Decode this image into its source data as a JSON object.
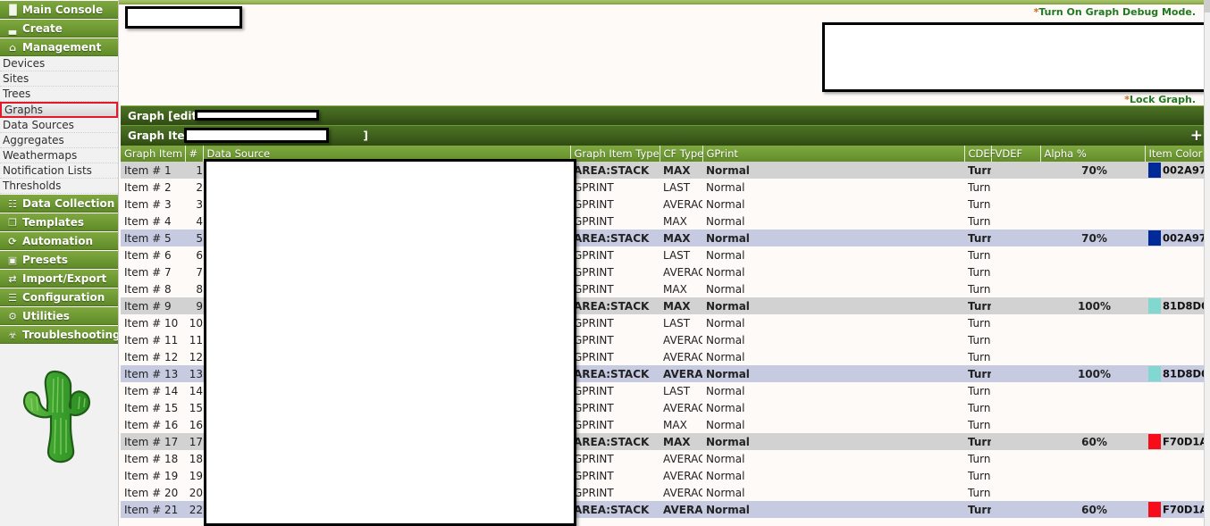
{
  "sidebar": {
    "groups_top": [
      {
        "label": "Main Console",
        "icon": "console-icon",
        "glyph": "▐▌"
      },
      {
        "label": "Create",
        "icon": "create-chart-icon",
        "glyph": "▃"
      },
      {
        "label": "Management",
        "icon": "home-icon",
        "glyph": "⌂"
      }
    ],
    "sub_items": [
      {
        "label": "Devices",
        "selected": false
      },
      {
        "label": "Sites",
        "selected": false
      },
      {
        "label": "Trees",
        "selected": false
      },
      {
        "label": "Graphs",
        "selected": true
      },
      {
        "label": "Data Sources",
        "selected": false
      },
      {
        "label": "Aggregates",
        "selected": false
      },
      {
        "label": "Weathermaps",
        "selected": false
      },
      {
        "label": "Notification Lists",
        "selected": false
      },
      {
        "label": "Thresholds",
        "selected": false
      }
    ],
    "groups_bottom": [
      {
        "label": "Data Collection",
        "icon": "database-icon",
        "glyph": "☷"
      },
      {
        "label": "Templates",
        "icon": "copy-icon",
        "glyph": "❐"
      },
      {
        "label": "Automation",
        "icon": "gear-rotate-icon",
        "glyph": "⟳"
      },
      {
        "label": "Presets",
        "icon": "window-icon",
        "glyph": "▣"
      },
      {
        "label": "Import/Export",
        "icon": "exchange-arrows-icon",
        "glyph": "⇄"
      },
      {
        "label": "Configuration",
        "icon": "sliders-icon",
        "glyph": "☰"
      },
      {
        "label": "Utilities",
        "icon": "cogs-icon",
        "glyph": "⚙"
      },
      {
        "label": "Troubleshooting",
        "icon": "bug-icon",
        "glyph": "☣"
      }
    ],
    "logo_alt": "cacti-cactus-logo"
  },
  "notes": {
    "debug_asterisk": "*",
    "debug_text": "Turn On Graph Debug Mode.",
    "lock_asterisk": "*",
    "lock_text": "Lock Graph."
  },
  "panel": {
    "graph_edit_label": "Graph [edit:",
    "graph_items_label": "Graph Items",
    "graph_items_close_bracket": "]",
    "add_button_glyph": "+"
  },
  "table": {
    "headers": {
      "graph_item": "Graph Item",
      "num": "#",
      "data_source": "Data Source",
      "graph_item_type": "Graph Item Type",
      "cf_type": "CF Type",
      "gprint": "GPrint",
      "cdef": "CDEF",
      "vdef": "VDEF",
      "alpha": "Alpha %",
      "item_color": "Item Color"
    },
    "rows": [
      {
        "item": "Item # 1",
        "num": "1",
        "hr": "",
        "type": "AREA:STACK",
        "cf": "MAX",
        "gprint": "Normal",
        "cdef": "Turn Bytes into Bits",
        "vdef": "",
        "alpha": "70%",
        "color": "002A97",
        "color_hex": "#002A97",
        "style": "gray",
        "down": true,
        "up": false,
        "del": true
      },
      {
        "item": "Item # 2",
        "num": "2",
        "hr": "",
        "type": "GPRINT",
        "cf": "LAST",
        "gprint": "Normal",
        "cdef": "Turn Bytes into Bits",
        "vdef": "",
        "alpha": "",
        "color": "",
        "color_hex": "",
        "style": "normal",
        "down": true,
        "up": true,
        "del": true
      },
      {
        "item": "Item # 3",
        "num": "3",
        "hr": "",
        "type": "GPRINT",
        "cf": "AVERAGE",
        "gprint": "Normal",
        "cdef": "Turn Bytes into Bits",
        "vdef": "",
        "alpha": "",
        "color": "",
        "color_hex": "",
        "style": "normal",
        "down": true,
        "up": true,
        "del": true
      },
      {
        "item": "Item # 4",
        "num": "4",
        "hr": "",
        "type": "GPRINT",
        "cf": "MAX",
        "gprint": "Normal",
        "cdef": "Turn Bytes into Bits",
        "vdef": "",
        "alpha": "",
        "color": "",
        "color_hex": "",
        "style": "normal",
        "down": true,
        "up": true,
        "del": true
      },
      {
        "item": "Item # 5",
        "num": "5",
        "hr": "",
        "type": "AREA:STACK",
        "cf": "MAX",
        "gprint": "Normal",
        "cdef": "Turn Bytes into Bits",
        "vdef": "",
        "alpha": "70%",
        "color": "002A97",
        "color_hex": "#002A97",
        "style": "blue",
        "down": true,
        "up": true,
        "del": true
      },
      {
        "item": "Item # 6",
        "num": "6",
        "hr": "",
        "type": "GPRINT",
        "cf": "LAST",
        "gprint": "Normal",
        "cdef": "Turn Bytes into Bits",
        "vdef": "",
        "alpha": "",
        "color": "",
        "color_hex": "",
        "style": "normal",
        "down": true,
        "up": true,
        "del": true
      },
      {
        "item": "Item # 7",
        "num": "7",
        "hr": "",
        "type": "GPRINT",
        "cf": "AVERAGE",
        "gprint": "Normal",
        "cdef": "Turn Bytes into Bits",
        "vdef": "",
        "alpha": "",
        "color": "",
        "color_hex": "",
        "style": "normal",
        "down": true,
        "up": true,
        "del": true
      },
      {
        "item": "Item # 8",
        "num": "8",
        "hr": "",
        "type": "GPRINT",
        "cf": "MAX",
        "gprint": "Normal",
        "cdef": "Turn Bytes into Bits",
        "vdef": "",
        "alpha": "",
        "color": "",
        "color_hex": "",
        "style": "normal",
        "down": true,
        "up": true,
        "del": true
      },
      {
        "item": "Item # 9",
        "num": "9",
        "hr": "",
        "type": "AREA:STACK",
        "cf": "MAX",
        "gprint": "Normal",
        "cdef": "Turn Bytes into Bits",
        "vdef": "",
        "alpha": "100%",
        "color": "81D8D0",
        "color_hex": "#81D8D0",
        "style": "gray",
        "down": true,
        "up": true,
        "del": true
      },
      {
        "item": "Item # 10",
        "num": "10",
        "hr": "",
        "type": "GPRINT",
        "cf": "LAST",
        "gprint": "Normal",
        "cdef": "Turn Bytes into Bits",
        "vdef": "",
        "alpha": "",
        "color": "",
        "color_hex": "",
        "style": "normal",
        "down": true,
        "up": true,
        "del": true
      },
      {
        "item": "Item # 11",
        "num": "11",
        "hr": "",
        "type": "GPRINT",
        "cf": "AVERAGE",
        "gprint": "Normal",
        "cdef": "Turn Bytes into Bits",
        "vdef": "",
        "alpha": "",
        "color": "",
        "color_hex": "",
        "style": "normal",
        "down": true,
        "up": true,
        "del": true
      },
      {
        "item": "Item # 12",
        "num": "12",
        "hr": "<HR>",
        "type": "GPRINT",
        "cf": "AVERAGE",
        "gprint": "Normal",
        "cdef": "Turn Bytes into Bits",
        "vdef": "",
        "alpha": "",
        "color": "",
        "color_hex": "",
        "style": "normal",
        "down": true,
        "up": true,
        "del": true
      },
      {
        "item": "Item # 13",
        "num": "13",
        "hr": "",
        "type": "AREA:STACK",
        "cf": "AVERAGE",
        "gprint": "Normal",
        "cdef": "Turn Bytes into Bits",
        "vdef": "",
        "alpha": "100%",
        "color": "81D8D0",
        "color_hex": "#81D8D0",
        "style": "blue",
        "down": true,
        "up": true,
        "del": true
      },
      {
        "item": "Item # 14",
        "num": "14",
        "hr": "",
        "type": "GPRINT",
        "cf": "LAST",
        "gprint": "Normal",
        "cdef": "Turn Bytes into Bits",
        "vdef": "",
        "alpha": "",
        "color": "",
        "color_hex": "",
        "style": "normal",
        "down": true,
        "up": true,
        "del": true
      },
      {
        "item": "Item # 15",
        "num": "15",
        "hr": "",
        "type": "GPRINT",
        "cf": "AVERAGE",
        "gprint": "Normal",
        "cdef": "Turn Bytes into Bits",
        "vdef": "",
        "alpha": "",
        "color": "",
        "color_hex": "",
        "style": "normal",
        "down": true,
        "up": true,
        "del": true
      },
      {
        "item": "Item # 16",
        "num": "16",
        "hr": "<HR>",
        "type": "GPRINT",
        "cf": "MAX",
        "gprint": "Normal",
        "cdef": "Turn Bytes into Bits",
        "vdef": "",
        "alpha": "",
        "color": "",
        "color_hex": "",
        "style": "normal",
        "down": true,
        "up": true,
        "del": true
      },
      {
        "item": "Item # 17",
        "num": "17",
        "hr": "",
        "type": "AREA:STACK",
        "cf": "MAX",
        "gprint": "Normal",
        "cdef": "Turn Bytes into Bits",
        "vdef": "",
        "alpha": "60%",
        "color": "F70D1A",
        "color_hex": "#F70D1A",
        "style": "gray",
        "down": true,
        "up": true,
        "del": true
      },
      {
        "item": "Item # 18",
        "num": "18",
        "hr": "",
        "type": "GPRINT",
        "cf": "AVERAGE",
        "gprint": "Normal",
        "cdef": "Turn Bytes into Bits",
        "vdef": "",
        "alpha": "",
        "color": "",
        "color_hex": "",
        "style": "normal",
        "down": true,
        "up": true,
        "del": true
      },
      {
        "item": "Item # 19",
        "num": "19",
        "hr": "",
        "type": "GPRINT",
        "cf": "AVERAGE",
        "gprint": "Normal",
        "cdef": "Turn Bytes into Bits",
        "vdef": "",
        "alpha": "",
        "color": "",
        "color_hex": "",
        "style": "normal",
        "down": true,
        "up": true,
        "del": true
      },
      {
        "item": "Item # 20",
        "num": "20",
        "hr": "",
        "type": "GPRINT",
        "cf": "AVERAGE",
        "gprint": "Normal",
        "cdef": "Turn Bytes into Bits",
        "vdef": "",
        "alpha": "",
        "color": "",
        "color_hex": "",
        "style": "normal",
        "down": true,
        "up": true,
        "del": true
      },
      {
        "item": "Item # 21",
        "num": "22",
        "hr": "",
        "type": "AREA:STACK",
        "cf": "AVERAGE",
        "gprint": "Normal",
        "cdef": "Turn Bytes into Bits",
        "vdef": "",
        "alpha": "60%",
        "color": "F70D1A",
        "color_hex": "#F70D1A",
        "style": "blue",
        "down": true,
        "up": true,
        "del": true
      }
    ]
  },
  "icons": {
    "arrow_down": "▼",
    "arrow_up": "▲",
    "delete": "✖"
  }
}
